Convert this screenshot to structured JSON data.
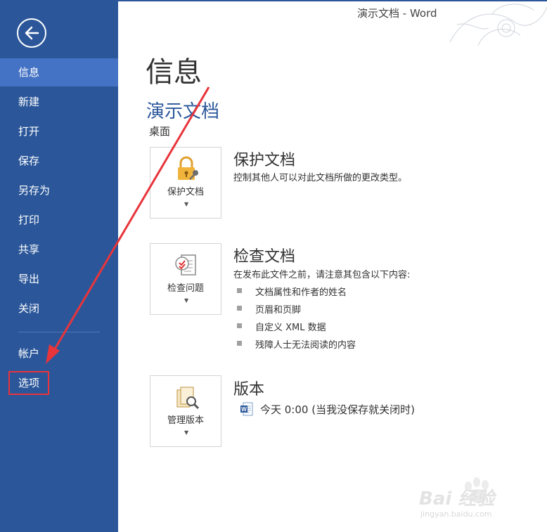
{
  "window": {
    "title": "演示文档 - Word"
  },
  "sidebar": {
    "items": [
      {
        "label": "信息"
      },
      {
        "label": "新建"
      },
      {
        "label": "打开"
      },
      {
        "label": "保存"
      },
      {
        "label": "另存为"
      },
      {
        "label": "打印"
      },
      {
        "label": "共享"
      },
      {
        "label": "导出"
      },
      {
        "label": "关闭"
      },
      {
        "label": "帐户"
      },
      {
        "label": "选项"
      }
    ],
    "active": "信息"
  },
  "main": {
    "page_title": "信息",
    "document_name": "演示文档",
    "document_location": "桌面",
    "protect": {
      "button_label": "保护文档",
      "title": "保护文档",
      "description": "控制其他人可以对此文档所做的更改类型。"
    },
    "inspect": {
      "button_label": "检查问题",
      "title": "检查文档",
      "description": "在发布此文件之前，请注意其包含以下内容:",
      "items": [
        "文档属性和作者的姓名",
        "页眉和页脚",
        "自定义 XML 数据",
        "残障人士无法阅读的内容"
      ]
    },
    "versions": {
      "button_label": "管理版本",
      "title": "版本",
      "entry": "今天 0:00 (当我没保存就关闭时)"
    }
  },
  "watermark": {
    "brand": "Bai 经验",
    "url": "jingyan.baidu.com"
  },
  "colors": {
    "sidebar": "#2b579a",
    "active_item": "#4472c4",
    "annotation": "#e8343b"
  }
}
